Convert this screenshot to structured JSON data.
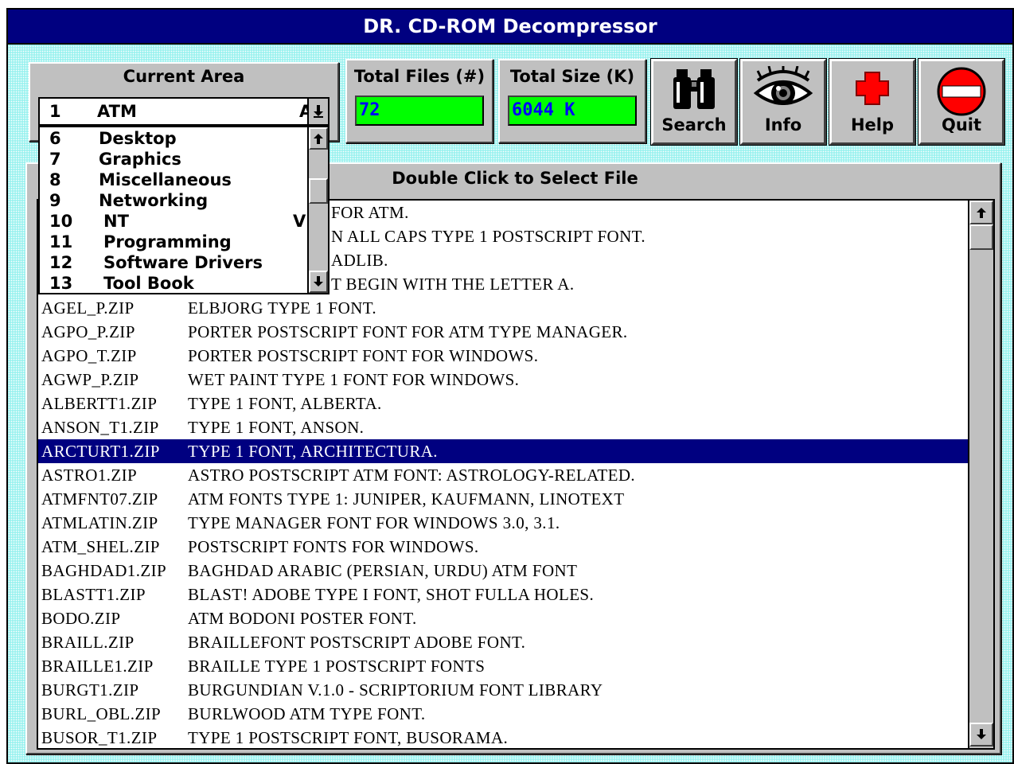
{
  "window": {
    "title": "DR. CD-ROM Decompressor"
  },
  "current_area": {
    "label": "Current Area",
    "selected": {
      "num": "1",
      "name": "ATM",
      "clipped": "A"
    },
    "items": [
      {
        "num": "6",
        "name": "Desktop",
        "extra": ""
      },
      {
        "num": "7",
        "name": "Graphics",
        "extra": ""
      },
      {
        "num": "8",
        "name": "Miscellaneous",
        "extra": ""
      },
      {
        "num": "9",
        "name": "Networking",
        "extra": ""
      },
      {
        "num": "10",
        "name": "NT",
        "extra": "V"
      },
      {
        "num": "11",
        "name": "Programming",
        "extra": ""
      },
      {
        "num": "12",
        "name": "Software Drivers",
        "extra": ""
      },
      {
        "num": "13",
        "name": "Tool Book",
        "extra": ""
      }
    ]
  },
  "stats": {
    "total_files_label": "Total Files (#)",
    "total_files_value": "72",
    "total_size_label": "Total Size (K)",
    "total_size_value": "6044 K"
  },
  "toolbar": {
    "search_label": "Search",
    "info_label": "Info",
    "help_label": "Help",
    "quit_label": "Quit"
  },
  "file_list": {
    "header": "Double Click to Select File",
    "partial_rows": [
      "FOR ATM.",
      "N ALL CAPS TYPE 1 POSTSCRIPT FONT.",
      "ADLIB.",
      "T BEGIN WITH THE LETTER A."
    ],
    "rows": [
      {
        "file": "AGEL_P.ZIP",
        "desc": "ELBJORG TYPE 1 FONT."
      },
      {
        "file": "AGPO_P.ZIP",
        "desc": "PORTER POSTSCRIPT FONT FOR ATM TYPE MANAGER."
      },
      {
        "file": "AGPO_T.ZIP",
        "desc": "PORTER POSTSCRIPT FONT FOR WINDOWS."
      },
      {
        "file": "AGWP_P.ZIP",
        "desc": "WET PAINT TYPE 1 FONT FOR WINDOWS."
      },
      {
        "file": "ALBERTT1.ZIP",
        "desc": "TYPE 1 FONT, ALBERTA."
      },
      {
        "file": "ANSON_T1.ZIP",
        "desc": "TYPE 1 FONT, ANSON."
      },
      {
        "file": "ARCTURT1.ZIP",
        "desc": "TYPE 1 FONT, ARCHITECTURA."
      },
      {
        "file": "ASTRO1.ZIP",
        "desc": "ASTRO POSTSCRIPT ATM FONT: ASTROLOGY-RELATED."
      },
      {
        "file": "ATMFNT07.ZIP",
        "desc": "ATM FONTS TYPE 1: JUNIPER, KAUFMANN, LINOTEXT"
      },
      {
        "file": "ATMLATIN.ZIP",
        "desc": "TYPE MANAGER FONT FOR WINDOWS 3.0, 3.1."
      },
      {
        "file": "ATM_SHEL.ZIP",
        "desc": "POSTSCRIPT FONTS FOR WINDOWS."
      },
      {
        "file": "BAGHDAD1.ZIP",
        "desc": "BAGHDAD ARABIC (PERSIAN, URDU) ATM FONT"
      },
      {
        "file": "BLASTT1.ZIP",
        "desc": "BLAST! ADOBE TYPE I FONT, SHOT FULLA HOLES."
      },
      {
        "file": "BODO.ZIP",
        "desc": "ATM BODONI POSTER FONT."
      },
      {
        "file": "BRAILL.ZIP",
        "desc": "BRAILLEFONT POSTSCRIPT ADOBE FONT."
      },
      {
        "file": "BRAILLE1.ZIP",
        "desc": "BRAILLE TYPE 1 POSTSCRIPT FONTS"
      },
      {
        "file": "BURGT1.ZIP",
        "desc": "BURGUNDIAN V.1.0 - SCRIPTORIUM FONT LIBRARY"
      },
      {
        "file": "BURL_OBL.ZIP",
        "desc": "BURLWOOD ATM TYPE FONT."
      },
      {
        "file": "BUSOR_T1.ZIP",
        "desc": "TYPE 1 POSTSCRIPT FONT, BUSORAMA."
      }
    ],
    "selected_file": "ARCTURT1.ZIP"
  },
  "colors": {
    "title_bar": "#000080",
    "selection": "#000080",
    "counter_bg": "#00ff00",
    "counter_text": "#0000ff",
    "background": "#9cf2ef",
    "help_cross": "#ff0000",
    "quit_sign": "#ff0000"
  },
  "icons": {
    "search": "binoculars-icon",
    "info": "eye-icon",
    "help": "red-cross-icon",
    "quit": "no-entry-icon",
    "scroll_up": "arrow-up-icon",
    "scroll_down": "arrow-down-icon"
  }
}
